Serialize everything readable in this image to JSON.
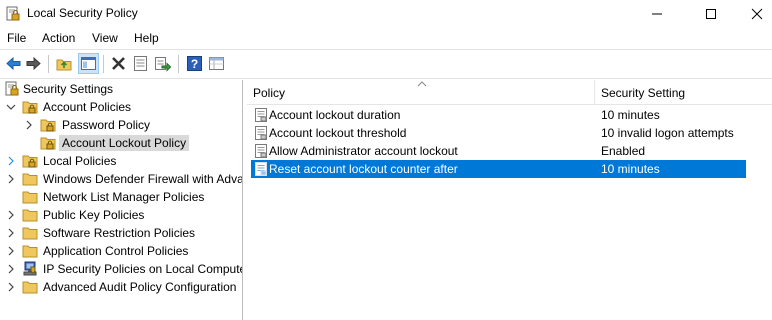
{
  "window": {
    "title": "Local Security Policy"
  },
  "menu": [
    "File",
    "Action",
    "View",
    "Help"
  ],
  "tree": {
    "root": "Security Settings",
    "account_policies": "Account Policies",
    "password_policy": "Password Policy",
    "account_lockout_policy": "Account Lockout Policy",
    "local_policies": "Local Policies",
    "firewall": "Windows Defender Firewall with Adva",
    "network_list": "Network List Manager Policies",
    "public_key": "Public Key Policies",
    "software_restriction": "Software Restriction Policies",
    "application_control": "Application Control Policies",
    "ip_security": "IP Security Policies on Local Compute",
    "audit": "Advanced Audit Policy Configuration"
  },
  "list": {
    "columns": {
      "policy": "Policy",
      "setting": "Security Setting"
    },
    "rows": [
      {
        "policy": "Account lockout duration",
        "setting": "10 minutes",
        "selected": false
      },
      {
        "policy": "Account lockout threshold",
        "setting": "10 invalid logon attempts",
        "selected": false
      },
      {
        "policy": "Allow Administrator account lockout",
        "setting": "Enabled",
        "selected": false
      },
      {
        "policy": "Reset account lockout counter after",
        "setting": "10 minutes",
        "selected": true
      }
    ]
  },
  "colors": {
    "selection": "#0078d7",
    "tree_selection": "#d9d9d9",
    "folder": "#f0c75e"
  },
  "icons": [
    "security-policy-icon",
    "back-icon",
    "forward-icon",
    "up-folder-icon",
    "show-hide-tree-icon",
    "delete-icon",
    "properties-icon",
    "export-list-icon",
    "help-icon",
    "view-icon",
    "folder-icon",
    "lock-folder-icon",
    "policy-icon"
  ]
}
